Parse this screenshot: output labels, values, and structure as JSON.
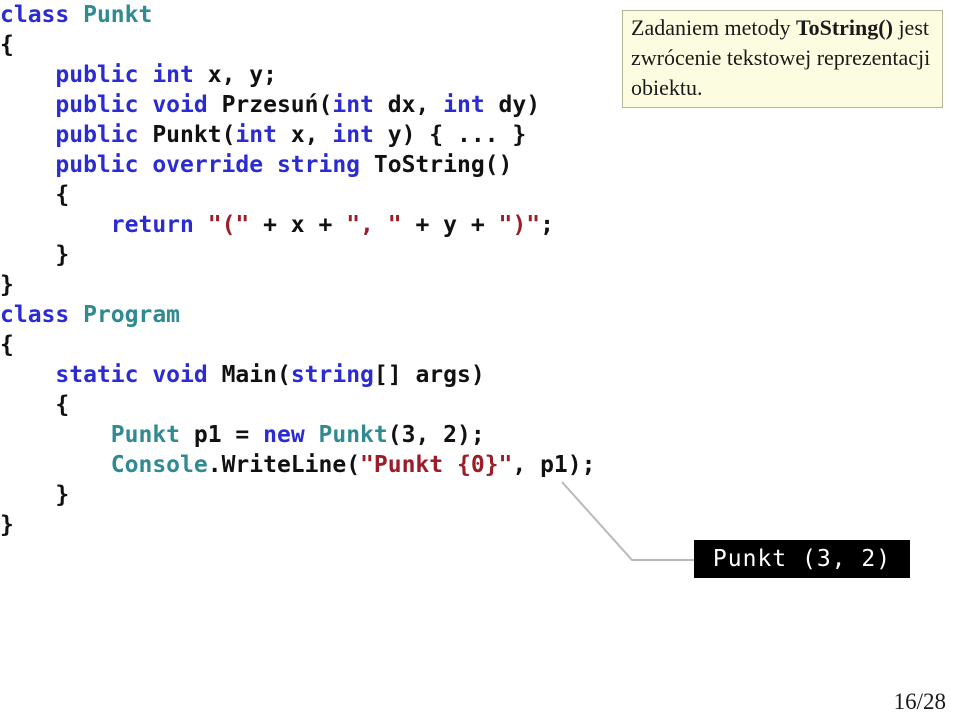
{
  "slide": {
    "page_number": "16/28"
  },
  "callout": {
    "name": "tostring-explanation-callout",
    "background_color": "#fcfce0",
    "border_color": "#b5b59a",
    "text_plain": "Zadaniem metody ToString() jest zwrócenie tekstowej reprezentacji obiektu.",
    "part1": "Zadaniem metody ",
    "part_bold": "ToString()",
    "part2": " jest zwrócenie tekstowej reprezentacji obiektu."
  },
  "console_output": {
    "text": "Punkt (3, 2)",
    "background_color": "#000000",
    "text_color": "#ffffff"
  },
  "colors": {
    "keyword": "#2b2bd4",
    "type": "#2f8a92",
    "string": "#9c1c28",
    "plain": "#111111"
  },
  "code": {
    "language": "csharp",
    "plain_text": "class Punkt\n{\n    public int x, y;\n    public void Przesuń(int dx, int dy)\n    public Punkt(int x, int y) { ... }\n    public override string ToString()\n    {\n        return \"(\" + x + \", \" + y + \")\";\n    }\n}\nclass Program\n{\n    static void Main(string[] args)\n    {\n        Punkt p1 = new Punkt(3, 2);\n        Console.WriteLine(\"Punkt {0}\", p1);\n    }\n}",
    "lines": [
      {
        "id": "line-1",
        "tokens": [
          {
            "t": "class ",
            "c": "kw"
          },
          {
            "t": "Punkt",
            "c": "typ"
          }
        ]
      },
      {
        "id": "line-2",
        "tokens": [
          {
            "t": "{",
            "c": "pl"
          }
        ]
      },
      {
        "id": "line-3",
        "tokens": [
          {
            "t": "    ",
            "c": "pl"
          },
          {
            "t": "public int ",
            "c": "kw"
          },
          {
            "t": "x, y;",
            "c": "pl"
          }
        ]
      },
      {
        "id": "line-4",
        "tokens": [
          {
            "t": "    ",
            "c": "pl"
          },
          {
            "t": "public void ",
            "c": "kw"
          },
          {
            "t": "Przesuń(",
            "c": "pl"
          },
          {
            "t": "int ",
            "c": "kw"
          },
          {
            "t": "dx, ",
            "c": "pl"
          },
          {
            "t": "int ",
            "c": "kw"
          },
          {
            "t": "dy)",
            "c": "pl"
          }
        ]
      },
      {
        "id": "line-5",
        "tokens": [
          {
            "t": "    ",
            "c": "pl"
          },
          {
            "t": "public ",
            "c": "kw"
          },
          {
            "t": "Punkt(",
            "c": "pl"
          },
          {
            "t": "int ",
            "c": "kw"
          },
          {
            "t": "x, ",
            "c": "pl"
          },
          {
            "t": "int ",
            "c": "kw"
          },
          {
            "t": "y) { ... }",
            "c": "pl"
          }
        ]
      },
      {
        "id": "line-6",
        "tokens": [
          {
            "t": "    ",
            "c": "pl"
          },
          {
            "t": "public override string ",
            "c": "kw"
          },
          {
            "t": "ToString()",
            "c": "pl"
          }
        ]
      },
      {
        "id": "line-7",
        "tokens": [
          {
            "t": "    {",
            "c": "pl"
          }
        ]
      },
      {
        "id": "line-8",
        "tokens": [
          {
            "t": "        ",
            "c": "pl"
          },
          {
            "t": "return ",
            "c": "kw"
          },
          {
            "t": "\"(\"",
            "c": "str"
          },
          {
            "t": " + x + ",
            "c": "pl"
          },
          {
            "t": "\", \"",
            "c": "str"
          },
          {
            "t": " + y + ",
            "c": "pl"
          },
          {
            "t": "\")\"",
            "c": "str"
          },
          {
            "t": ";",
            "c": "pl"
          }
        ]
      },
      {
        "id": "line-9",
        "tokens": [
          {
            "t": "    }",
            "c": "pl"
          }
        ]
      },
      {
        "id": "line-10",
        "tokens": [
          {
            "t": "}",
            "c": "pl"
          }
        ]
      },
      {
        "id": "line-11",
        "tokens": [
          {
            "t": "class ",
            "c": "kw"
          },
          {
            "t": "Program",
            "c": "typ"
          }
        ]
      },
      {
        "id": "line-12",
        "tokens": [
          {
            "t": "{",
            "c": "pl"
          }
        ]
      },
      {
        "id": "line-13",
        "tokens": [
          {
            "t": "    ",
            "c": "pl"
          },
          {
            "t": "static void ",
            "c": "kw"
          },
          {
            "t": "Main(",
            "c": "pl"
          },
          {
            "t": "string",
            "c": "kw"
          },
          {
            "t": "[] args)",
            "c": "pl"
          }
        ]
      },
      {
        "id": "line-14",
        "tokens": [
          {
            "t": "    {",
            "c": "pl"
          }
        ]
      },
      {
        "id": "line-15",
        "tokens": [
          {
            "t": "        ",
            "c": "pl"
          },
          {
            "t": "Punkt",
            "c": "typ"
          },
          {
            "t": " p1 = ",
            "c": "pl"
          },
          {
            "t": "new ",
            "c": "kw"
          },
          {
            "t": "Punkt",
            "c": "typ"
          },
          {
            "t": "(3, 2);",
            "c": "pl"
          }
        ]
      },
      {
        "id": "line-16",
        "tokens": [
          {
            "t": "        ",
            "c": "pl"
          },
          {
            "t": "Console",
            "c": "typ"
          },
          {
            "t": ".WriteLine(",
            "c": "pl"
          },
          {
            "t": "\"Punkt {0}\"",
            "c": "str"
          },
          {
            "t": ", p1);",
            "c": "pl"
          }
        ]
      },
      {
        "id": "line-17",
        "tokens": [
          {
            "t": "    }",
            "c": "pl"
          }
        ]
      },
      {
        "id": "line-18",
        "tokens": [
          {
            "t": "}",
            "c": "pl"
          }
        ]
      }
    ]
  }
}
